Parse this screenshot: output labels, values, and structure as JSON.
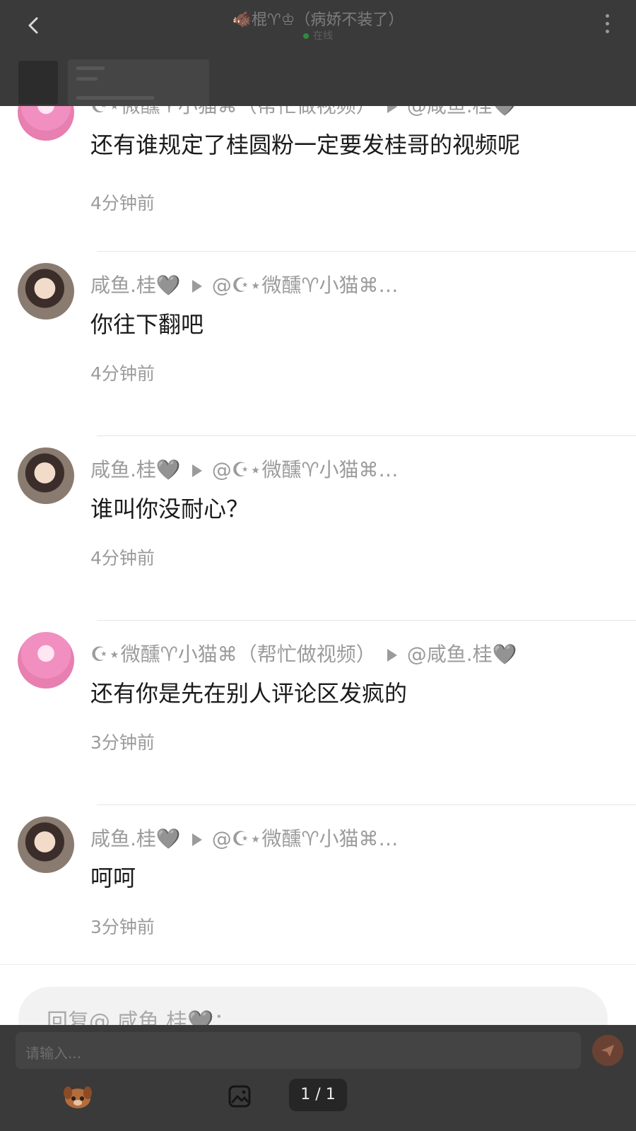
{
  "header": {
    "title": "🐗棍♈︎♔（病娇不装了）",
    "status": "在线"
  },
  "comments": [
    {
      "username": "☪⋆微醺♈︎小猫⌘（帮忙做视频）",
      "reply_to": "@咸鱼.桂🩶",
      "text": "还有谁规定了桂圆粉一定要发桂哥的视频呢",
      "time": "4分钟前",
      "avatar": "pink-anime-avatar"
    },
    {
      "username": "咸鱼.桂🩶",
      "reply_to": "@☪⋆微醺♈︎小猫⌘…",
      "text": "你往下翻吧",
      "time": "4分钟前",
      "avatar": "photo-avatar"
    },
    {
      "username": "咸鱼.桂🩶",
      "reply_to": "@☪⋆微醺♈︎小猫⌘…",
      "text": "谁叫你没耐心？",
      "time": "4分钟前",
      "avatar": "photo-avatar"
    },
    {
      "username": "☪⋆微醺♈︎小猫⌘（帮忙做视频）",
      "reply_to": "@咸鱼.桂🩶",
      "text": "还有你是先在别人评论区发疯的",
      "time": "3分钟前",
      "avatar": "pink-anime-avatar"
    },
    {
      "username": "咸鱼.桂🩶",
      "reply_to": "@☪⋆微醺♈︎小猫⌘…",
      "text": "呵呵",
      "time": "3分钟前",
      "avatar": "photo-avatar"
    }
  ],
  "reply_box": {
    "placeholder": "回复@ 咸鱼.桂🩶："
  },
  "bottom_bar": {
    "input_placeholder": "请输入...",
    "page_indicator": "1 / 1"
  }
}
